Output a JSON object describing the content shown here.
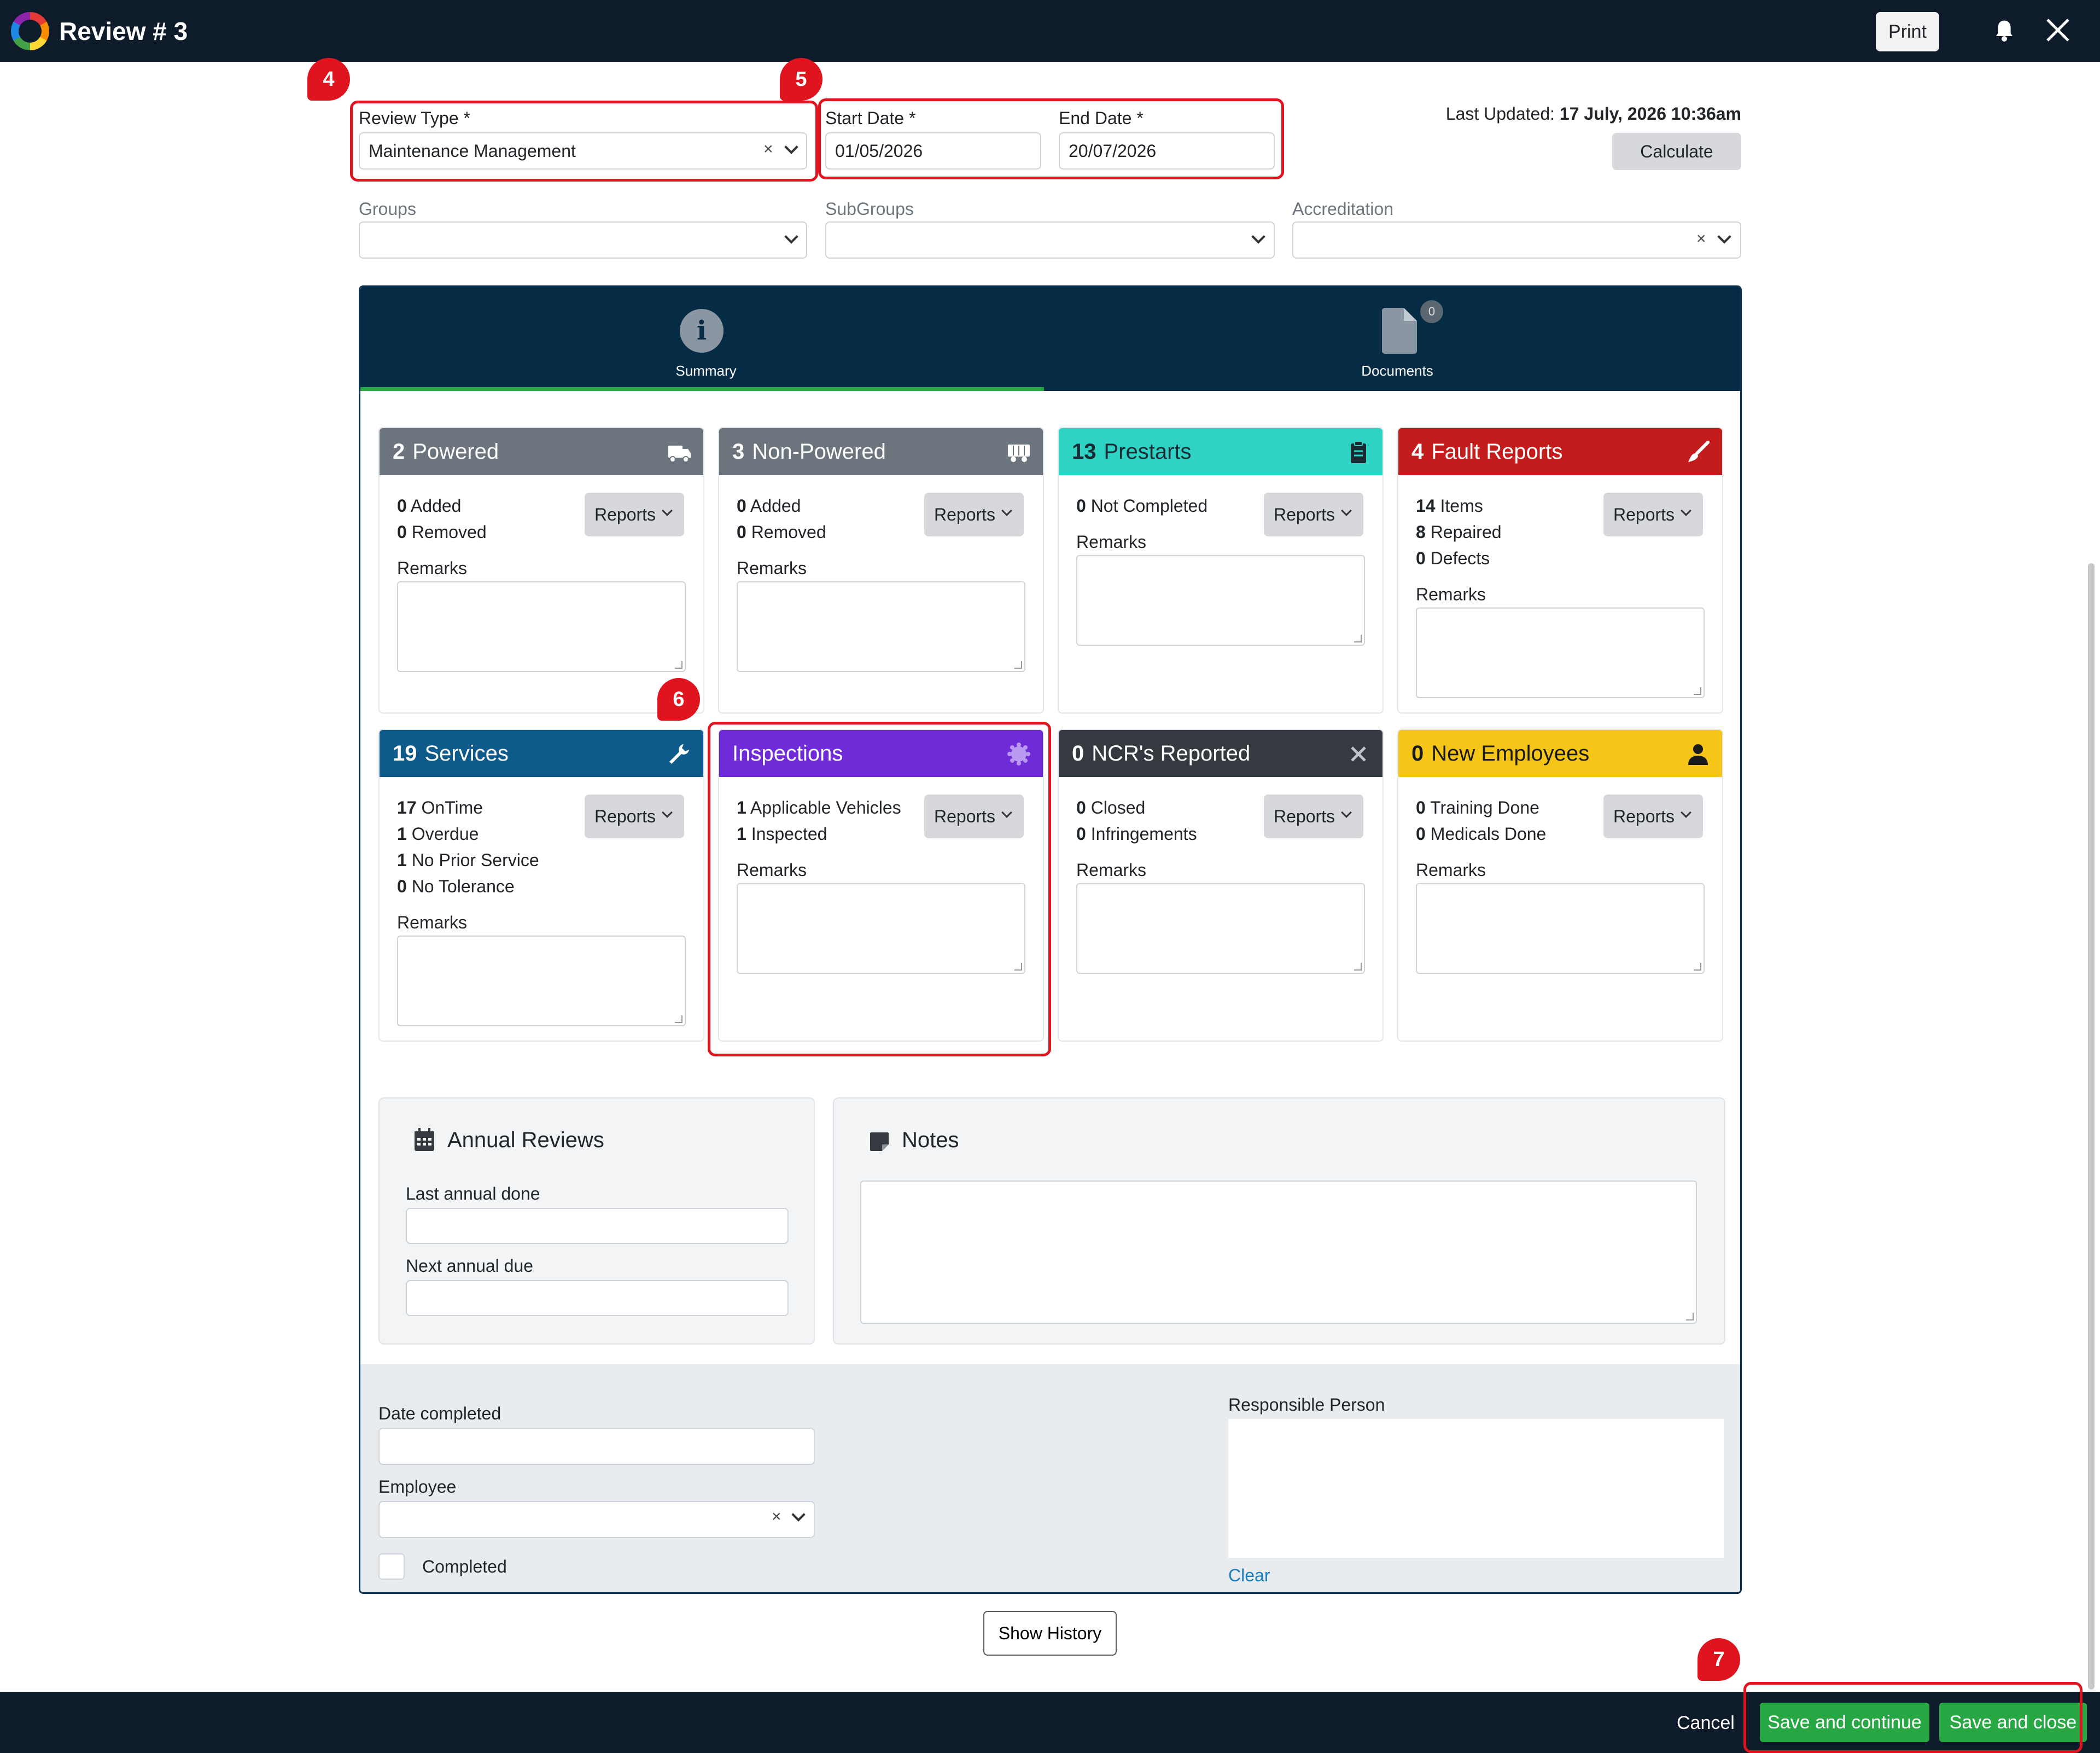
{
  "header": {
    "title": "Review # 3",
    "print_label": "Print",
    "icons": [
      "logo-icon",
      "bell-icon",
      "close-icon"
    ]
  },
  "form": {
    "review_type": {
      "label": "Review Type *",
      "value": "Maintenance Management"
    },
    "start_date": {
      "label": "Start Date *",
      "value": "01/05/2026"
    },
    "end_date": {
      "label": "End Date *",
      "value": "20/07/2026"
    },
    "last_updated_label": "Last Updated:",
    "last_updated_value": "17 July, 2026 10:36am",
    "calculate_label": "Calculate",
    "groups_label": "Groups",
    "subgroups_label": "SubGroups",
    "accreditation_label": "Accreditation"
  },
  "tabs": [
    {
      "label": "Summary",
      "icon": "info-icon"
    },
    {
      "label": "Documents",
      "icon": "document-icon",
      "count": "0"
    }
  ],
  "common": {
    "reports_label": "Reports",
    "remarks_label": "Remarks"
  },
  "cards": {
    "powered": {
      "num": "2",
      "title": "Powered",
      "color": "#6c757d",
      "stats": [
        {
          "n": "0",
          "t": "Added"
        },
        {
          "n": "0",
          "t": "Removed"
        }
      ]
    },
    "non_powered": {
      "num": "3",
      "title": "Non-Powered",
      "color": "#6c757d",
      "stats": [
        {
          "n": "0",
          "t": "Added"
        },
        {
          "n": "0",
          "t": "Removed"
        }
      ]
    },
    "prestarts": {
      "num": "13",
      "title": "Prestarts",
      "color": "#2fd3c4",
      "stats": [
        {
          "n": "0",
          "t": "Not Completed"
        }
      ]
    },
    "fault_reports": {
      "num": "4",
      "title": "Fault Reports",
      "color": "#c21c1c",
      "stats": [
        {
          "n": "14",
          "t": "Items"
        },
        {
          "n": "8",
          "t": "Repaired"
        },
        {
          "n": "0",
          "t": "Defects"
        }
      ]
    },
    "services": {
      "num": "19",
      "title": "Services",
      "color": "#0e5a8a",
      "stats": [
        {
          "n": "17",
          "t": "OnTime"
        },
        {
          "n": "1",
          "t": "Overdue"
        },
        {
          "n": "1",
          "t": "No Prior Service"
        },
        {
          "n": "0",
          "t": "No Tolerance"
        }
      ]
    },
    "inspections": {
      "num": "",
      "title": "Inspections",
      "color": "#6f2bd8",
      "stats": [
        {
          "n": "1",
          "t": "Applicable Vehicles"
        },
        {
          "n": "1",
          "t": "Inspected"
        }
      ]
    },
    "ncr": {
      "num": "0",
      "title": "NCR's Reported",
      "color": "#343a40",
      "stats": [
        {
          "n": "0",
          "t": "Closed"
        },
        {
          "n": "0",
          "t": "Infringements"
        }
      ]
    },
    "new_employees": {
      "num": "0",
      "title": "New Employees",
      "color": "#f5c518",
      "stats": [
        {
          "n": "0",
          "t": "Training Done"
        },
        {
          "n": "0",
          "t": "Medicals Done"
        }
      ]
    }
  },
  "annual": {
    "title": "Annual Reviews",
    "last_label": "Last annual done",
    "next_label": "Next annual due"
  },
  "notes": {
    "title": "Notes"
  },
  "completion": {
    "date_completed_label": "Date completed",
    "employee_label": "Employee",
    "completed_label": "Completed",
    "responsible_label": "Responsible Person",
    "clear_label": "Clear"
  },
  "history_label": "Show History",
  "footer": {
    "cancel_label": "Cancel",
    "save_continue_label": "Save and continue",
    "save_close_label": "Save and close"
  },
  "annotations": [
    "4",
    "5",
    "6",
    "7"
  ]
}
